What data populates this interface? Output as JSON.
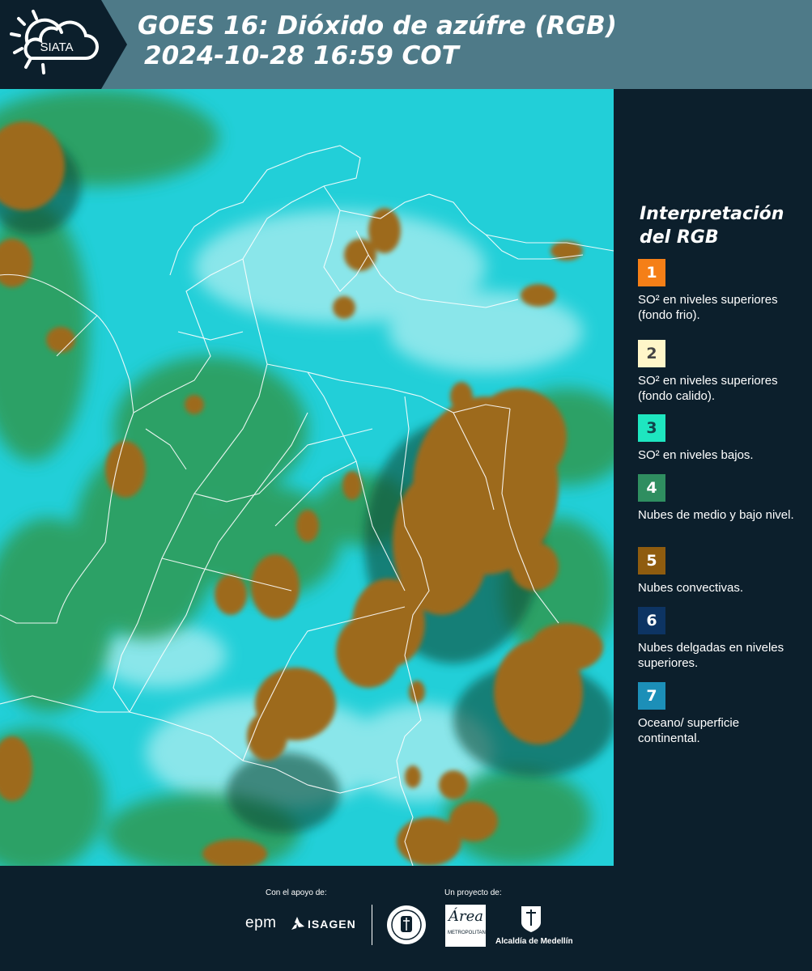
{
  "header": {
    "logo_text": "SIATA",
    "title_line1": "GOES 16: Dióxido de azúfre (RGB)",
    "title_line2": "2024-10-28 16:59 COT"
  },
  "map": {
    "description_icon": "satellite-rgb-map",
    "background_color": "#22cfd8"
  },
  "legend": {
    "title": "Interpretación del RGB",
    "items": [
      {
        "number": "1",
        "color": "#f57f17",
        "text_color": "#ffffff",
        "label": "SO² en niveles superiores (fondo frio)."
      },
      {
        "number": "2",
        "color": "#fff6c9",
        "text_color": "#444444",
        "label": "SO² en niveles superiores (fondo calido)."
      },
      {
        "number": "3",
        "color": "#1ee6c0",
        "text_color": "#10434a",
        "label": "SO² en niveles bajos."
      },
      {
        "number": "4",
        "color": "#2f8e60",
        "text_color": "#ffffff",
        "label": "Nubes de medio y bajo nivel."
      },
      {
        "number": "5",
        "color": "#8f5c0f",
        "text_color": "#ffffff",
        "label": "Nubes convectivas."
      },
      {
        "number": "6",
        "color": "#0d3463",
        "text_color": "#ffffff",
        "label": "Nubes delgadas en niveles superiores."
      },
      {
        "number": "7",
        "color": "#1c8fb8",
        "text_color": "#ffffff",
        "label": "Oceano/ superficie continental."
      }
    ]
  },
  "footer": {
    "support_caption": "Con el apoyo de:",
    "project_caption": "Un proyecto de:",
    "sponsor_epm": "epm",
    "sponsor_isagen": "ISAGEN",
    "area_metropolitana": "Área",
    "area_subtitle": "METROPOLITANA",
    "alcaldia": "Alcaldía de Medellín"
  }
}
